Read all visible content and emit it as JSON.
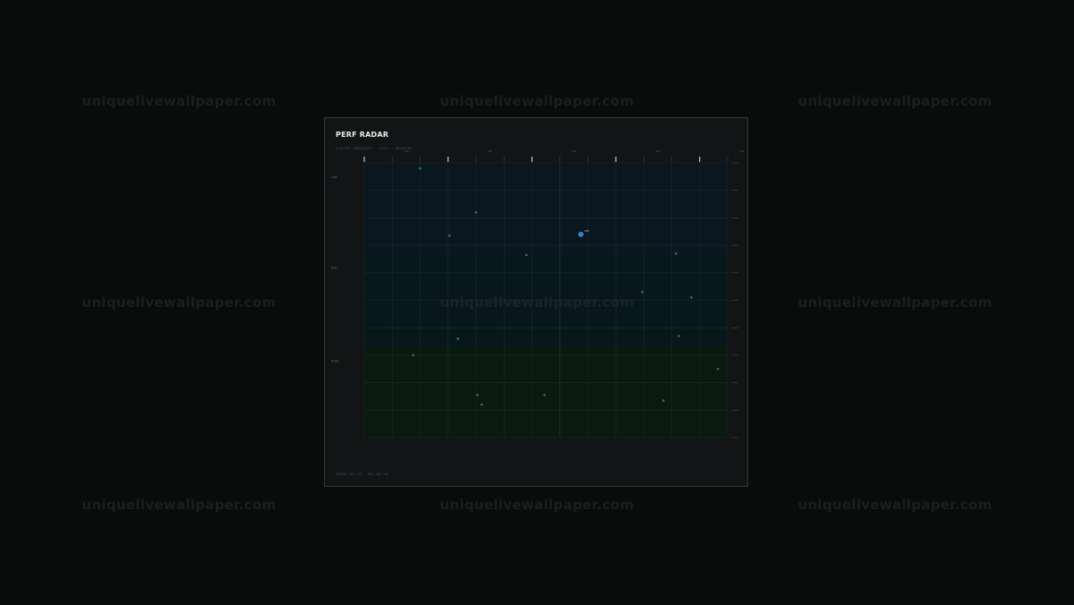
{
  "watermark": "uniquelivewallpaper.com",
  "panel": {
    "title": "PERF RADAR",
    "subtitle": "CLUSTER THROUGHPUT · SCALE · OBSERVED",
    "footer": "SPREAD 302.7/S · P95 +48.7KS"
  },
  "colors": {
    "background": "#0a0c0b",
    "panel": "#121415",
    "band_high": "#0a1620",
    "band_mid": "#08181a",
    "band_low": "#0a1a0e",
    "grid": "#1f2d2b",
    "highlight": "#3b82c4",
    "point": "#3f6e6a"
  },
  "chart_data": {
    "type": "scatter",
    "title": "PERF RADAR",
    "xlim": [
      0,
      13
    ],
    "ylim": [
      0,
      10
    ],
    "x_ticks": [
      "100",
      "200",
      "300",
      "400",
      "500"
    ],
    "bands": [
      {
        "label": "LOW",
        "from": 6.7,
        "to": 10,
        "color": "#0a1620",
        "label_color": "#3b6f8c"
      },
      {
        "label": "MID",
        "from": 3.3,
        "to": 6.7,
        "color": "#08181a",
        "label_color": "#2f7f6c"
      },
      {
        "label": "HIGH",
        "from": 0,
        "to": 3.3,
        "color": "#0a1a0e",
        "label_color": "#3c8a3a"
      }
    ],
    "points": [
      {
        "x": 2.0,
        "y": 9.8
      },
      {
        "x": 4.0,
        "y": 8.2
      },
      {
        "x": 3.05,
        "y": 7.35
      },
      {
        "x": 7.75,
        "y": 7.4,
        "highlight": true,
        "label": "083"
      },
      {
        "x": 5.8,
        "y": 6.65
      },
      {
        "x": 11.15,
        "y": 6.7
      },
      {
        "x": 9.95,
        "y": 5.3
      },
      {
        "x": 11.7,
        "y": 5.1
      },
      {
        "x": 3.35,
        "y": 3.6
      },
      {
        "x": 11.25,
        "y": 3.7
      },
      {
        "x": 1.75,
        "y": 3.0
      },
      {
        "x": 12.65,
        "y": 2.5
      },
      {
        "x": 4.05,
        "y": 1.55
      },
      {
        "x": 6.45,
        "y": 1.55
      },
      {
        "x": 4.2,
        "y": 1.2
      },
      {
        "x": 10.7,
        "y": 1.35
      }
    ]
  }
}
